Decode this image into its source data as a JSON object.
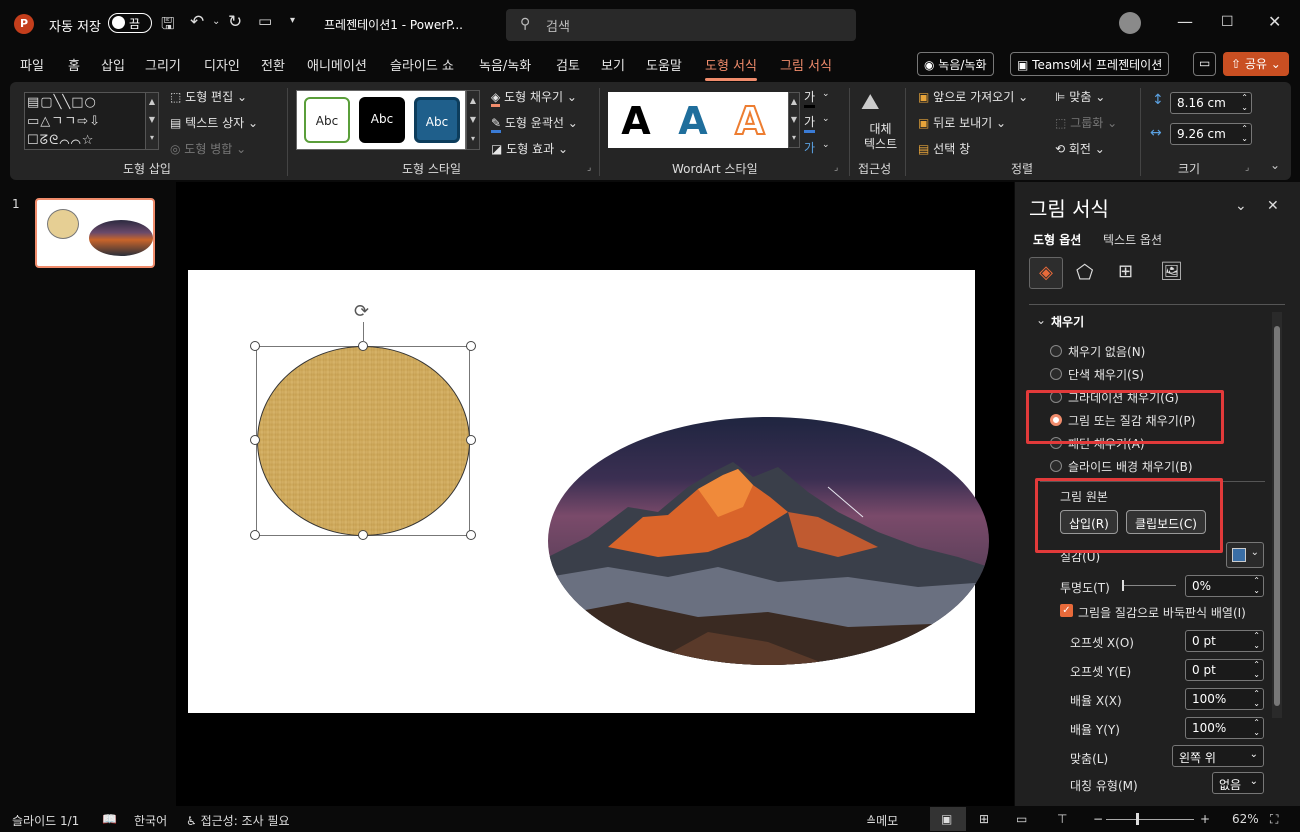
{
  "titlebar": {
    "autosave_label": "자동 저장",
    "autosave_state": "끔",
    "filename": "프레젠테이션1",
    "app": "PowerP...",
    "separator": "-",
    "search_placeholder": "검색"
  },
  "menu": {
    "items": [
      "파일",
      "홈",
      "삽입",
      "그리기",
      "디자인",
      "전환",
      "애니메이션",
      "슬라이드 쇼",
      "녹음/녹화",
      "검토",
      "보기",
      "도움말",
      "도형 서식",
      "그림 서식"
    ],
    "record_button": "녹음/녹화",
    "teams_button": "Teams에서 프레젠테이션",
    "share_button": "공유"
  },
  "ribbon": {
    "insert_shapes": {
      "label": "도형 삽입",
      "edit_shape": "도형 편집",
      "text_box": "텍스트 상자",
      "merge_shapes": "도형 병합"
    },
    "shape_styles": {
      "label": "도형 스타일",
      "preset": "Abc",
      "fill": "도형 채우기",
      "outline": "도형 윤곽선",
      "effects": "도형 효과"
    },
    "wordart": {
      "label": "WordArt 스타일",
      "letter": "A",
      "text_fill_glyph": "가",
      "text_outline_glyph": "가",
      "text_effects_glyph": "가"
    },
    "accessibility": {
      "label": "접근성",
      "alt_text_line1": "대체",
      "alt_text_line2": "텍스트"
    },
    "arrange": {
      "label": "정렬",
      "bring_forward": "앞으로 가져오기",
      "send_backward": "뒤로 보내기",
      "selection_pane": "선택 창",
      "align": "맞춤",
      "group": "그룹화",
      "rotate": "회전"
    },
    "size": {
      "label": "크기",
      "height": "8.16 cm",
      "width": "9.26 cm"
    }
  },
  "thumbnails": {
    "slide_number": "1"
  },
  "format_pane": {
    "title": "그림 서식",
    "tabs": [
      "도형 옵션",
      "텍스트 옵션"
    ],
    "section": "채우기",
    "fill_options": [
      "채우기 없음(N)",
      "단색 채우기(S)",
      "그라데이션 채우기(G)",
      "그림 또는 질감 채우기(P)",
      "패턴 채우기(A)",
      "슬라이드 배경 채우기(B)"
    ],
    "selected_fill_index": 3,
    "picture_source": {
      "label": "그림 원본",
      "insert": "삽입(R)",
      "clipboard": "클립보드(C)"
    },
    "texture_label": "질감(U)",
    "transparency": {
      "label": "투명도(T)",
      "value": "0%"
    },
    "tile_checkbox": {
      "label": "그림을 질감으로 바둑판식 배열(I)",
      "checked": true
    },
    "offset_x": {
      "label": "오프셋 X(O)",
      "value": "0 pt"
    },
    "offset_y": {
      "label": "오프셋 Y(E)",
      "value": "0 pt"
    },
    "scale_x": {
      "label": "배율 X(X)",
      "value": "100%"
    },
    "scale_y": {
      "label": "배율 Y(Y)",
      "value": "100%"
    },
    "alignment": {
      "label": "맞춤(L)",
      "value": "왼쪽 위"
    },
    "mirror": {
      "label": "대칭 유형(M)",
      "value": "없음"
    }
  },
  "statusbar": {
    "slide": "슬라이드 1/1",
    "language": "한국어",
    "accessibility": "접근성: 조사 필요",
    "notes": "메모",
    "zoom": "62%"
  },
  "colors": {
    "accent": "#f08c6c",
    "highlight_box": "#e23a3a",
    "share": "#c94f22"
  }
}
